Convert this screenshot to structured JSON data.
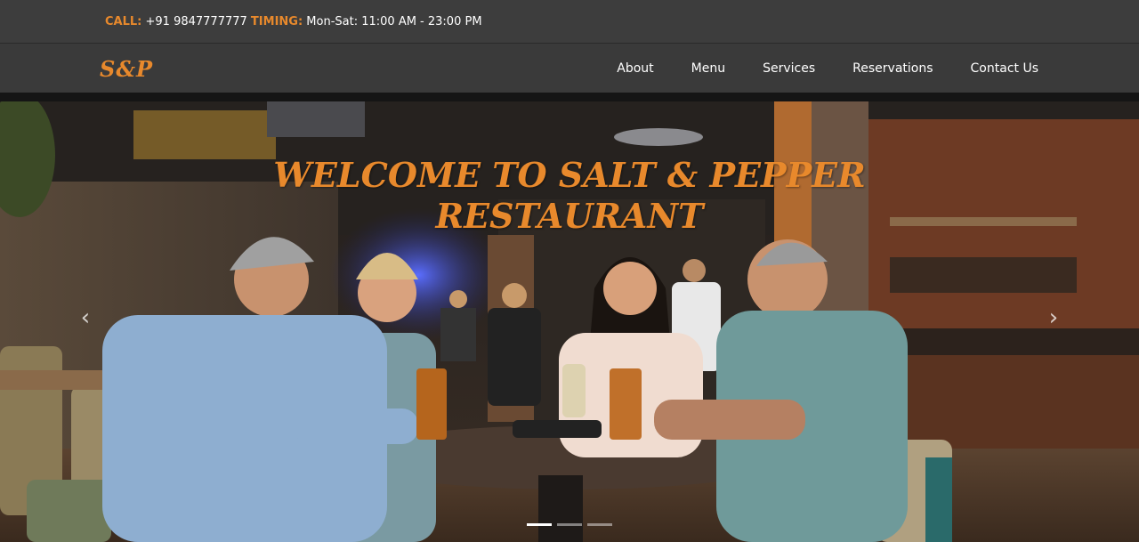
{
  "topbar": {
    "call_label": "CALL:",
    "phone": " +91 9847777777 ",
    "timing_label": "TIMING:",
    "hours": " Mon-Sat: 11:00 AM - 23:00 PM"
  },
  "brand": {
    "logo": "S&P"
  },
  "nav": {
    "items": [
      {
        "label": "About"
      },
      {
        "label": "Menu"
      },
      {
        "label": "Services"
      },
      {
        "label": "Reservations"
      },
      {
        "label": "Contact Us"
      }
    ]
  },
  "hero": {
    "title_line1": "WELCOME TO SALT & PEPPER",
    "title_line2": "RESTAURANT",
    "prev_icon": "chevron-left-icon",
    "next_icon": "chevron-right-icon",
    "prev_glyph": "‹",
    "next_glyph": "›",
    "slides_total": 3,
    "active_slide": 1
  },
  "colors": {
    "accent": "#e8892c",
    "topbar_bg": "#3d3d3d",
    "navbar_bg": "#3a3a3a"
  }
}
